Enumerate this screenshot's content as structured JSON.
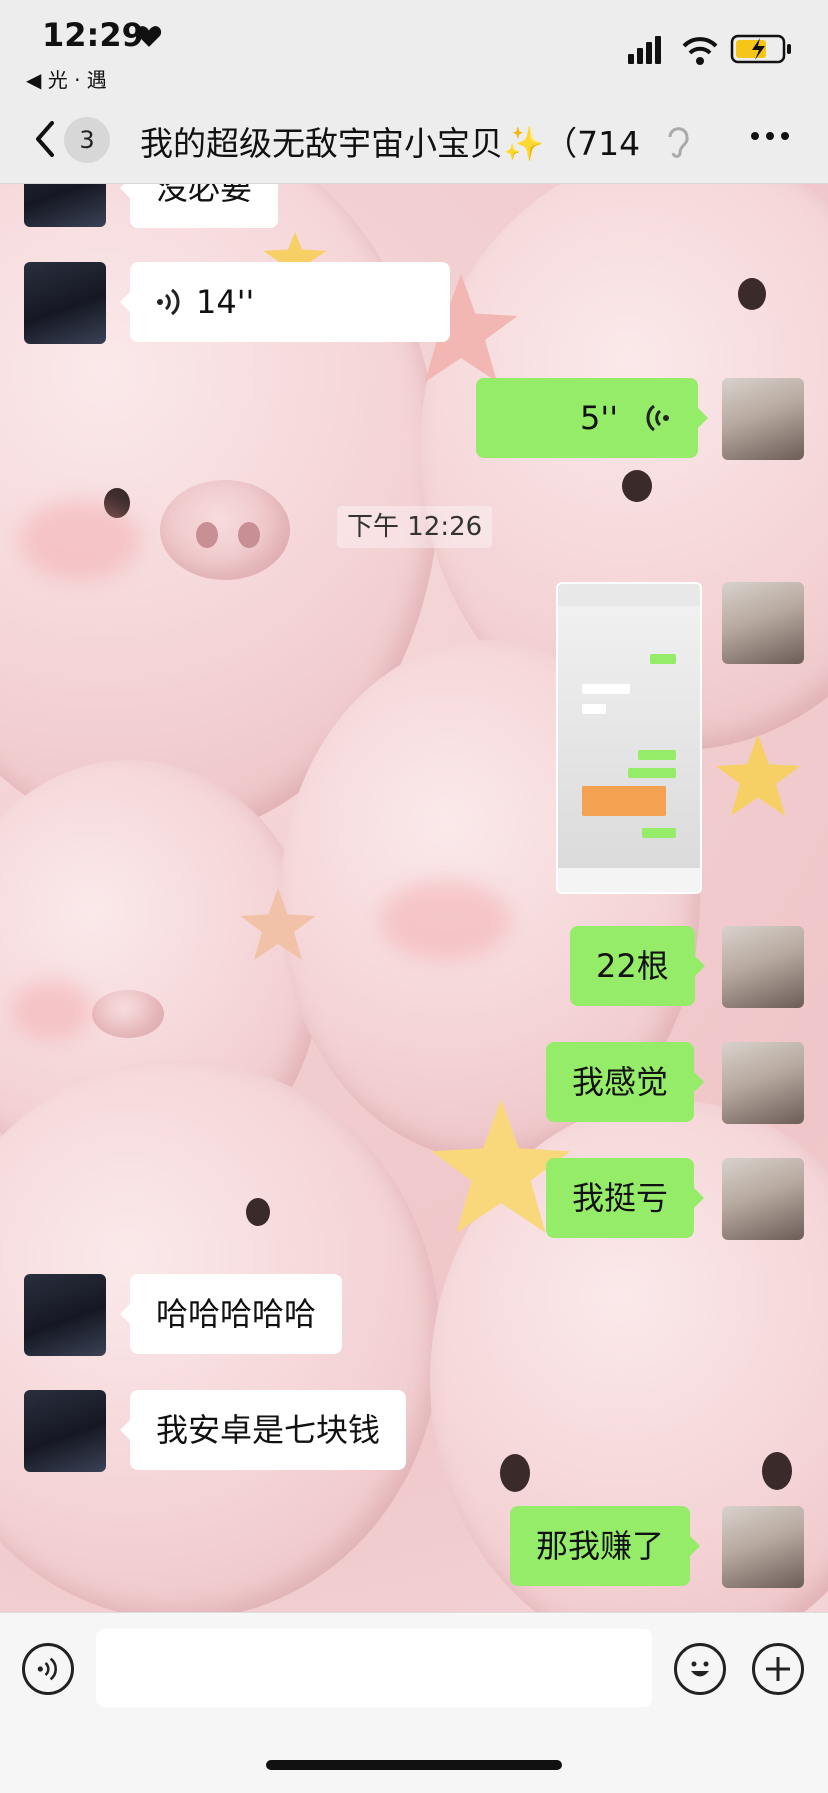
{
  "status_bar": {
    "time": "12:29",
    "back_app": "◀ 光 · 遇"
  },
  "nav": {
    "unread_count": "3",
    "title": "我的超级无敌宇宙小宝贝✨（714"
  },
  "messages": [
    {
      "side": "left",
      "text": "没必要"
    },
    {
      "side": "left",
      "type": "voice",
      "duration": "14''"
    },
    {
      "side": "right",
      "type": "voice",
      "duration": "5''"
    },
    {
      "type": "timestamp",
      "text": "下午 12:26"
    },
    {
      "side": "right",
      "type": "image"
    },
    {
      "side": "right",
      "text": "22根"
    },
    {
      "side": "right",
      "text": "我感觉"
    },
    {
      "side": "right",
      "text": "我挺亏"
    },
    {
      "side": "left",
      "text": "哈哈哈哈哈"
    },
    {
      "side": "left",
      "text": "我安卓是七块钱"
    },
    {
      "side": "right",
      "text": "那我赚了"
    }
  ],
  "colors": {
    "bubble_sent": "#95ec69",
    "bubble_received": "#ffffff",
    "bar_bg": "#ededed"
  }
}
